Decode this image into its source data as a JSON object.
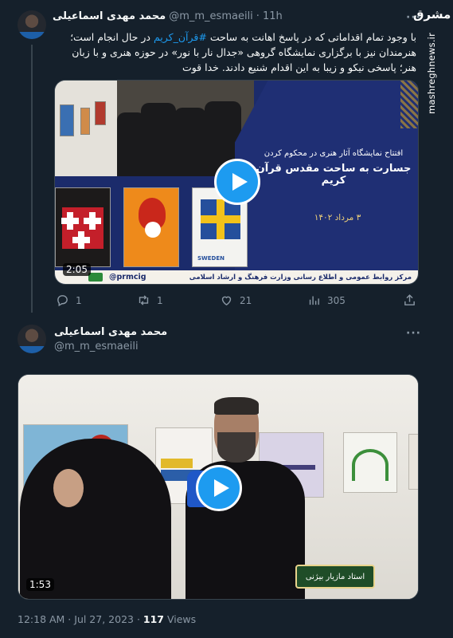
{
  "tweet1": {
    "author_name": "محمد مهدی اسماعیلی",
    "handle": "@m_m_esmaeili",
    "separator": "·",
    "time": "11h",
    "text_before": "با وجود تمام اقداماتی که در پاسخ اهانت به ساحت ",
    "hashtag": "#قرآن_کریم",
    "text_after": " در حال انجام است؛ هنرمندان نیز با برگزاری نمایشگاه گروهی «جدال نار با نور» در حوزه هنری و با زبان هنر؛ پاسخی نیکو و زیبا به این اقدام شنیع دادند. خدا قوت",
    "video": {
      "title_line1": "افتتاح نمایشگاه آثار هنری در محکوم کردن",
      "title_line2": "جسارت به ساحت مقدس قرآن کریم",
      "date": "۳ مرداد ۱۴۰۲",
      "org": "مرکز روابط عمومی و اطلاع رسانی وزارت فرهنگ و ارشاد اسلامی",
      "channel_handle": "@prmcig",
      "poster_text": "SWEDEN",
      "duration": "2:05"
    },
    "stats": {
      "replies": "1",
      "retweets": "1",
      "likes": "21",
      "views": "305"
    }
  },
  "tweet2": {
    "author_name": "محمد مهدی اسماعیلی",
    "handle": "@m_m_esmaeili",
    "video": {
      "caption_sign": "استاد مازیار بیژنی",
      "duration": "1:53"
    },
    "timestamp": "12:18 AM · Jul 27, 2023 · ",
    "views_count": "117",
    "views_label": " Views"
  },
  "watermark": {
    "logo": "مشرق",
    "site": "mashreghnews.ir"
  },
  "colors": {
    "background": "#15202b",
    "accent": "#1d9bf0",
    "secondary_text": "#8b98a5"
  },
  "icons": [
    "reply-icon",
    "retweet-icon",
    "like-icon",
    "views-icon",
    "share-icon",
    "more-icon",
    "play-icon"
  ]
}
